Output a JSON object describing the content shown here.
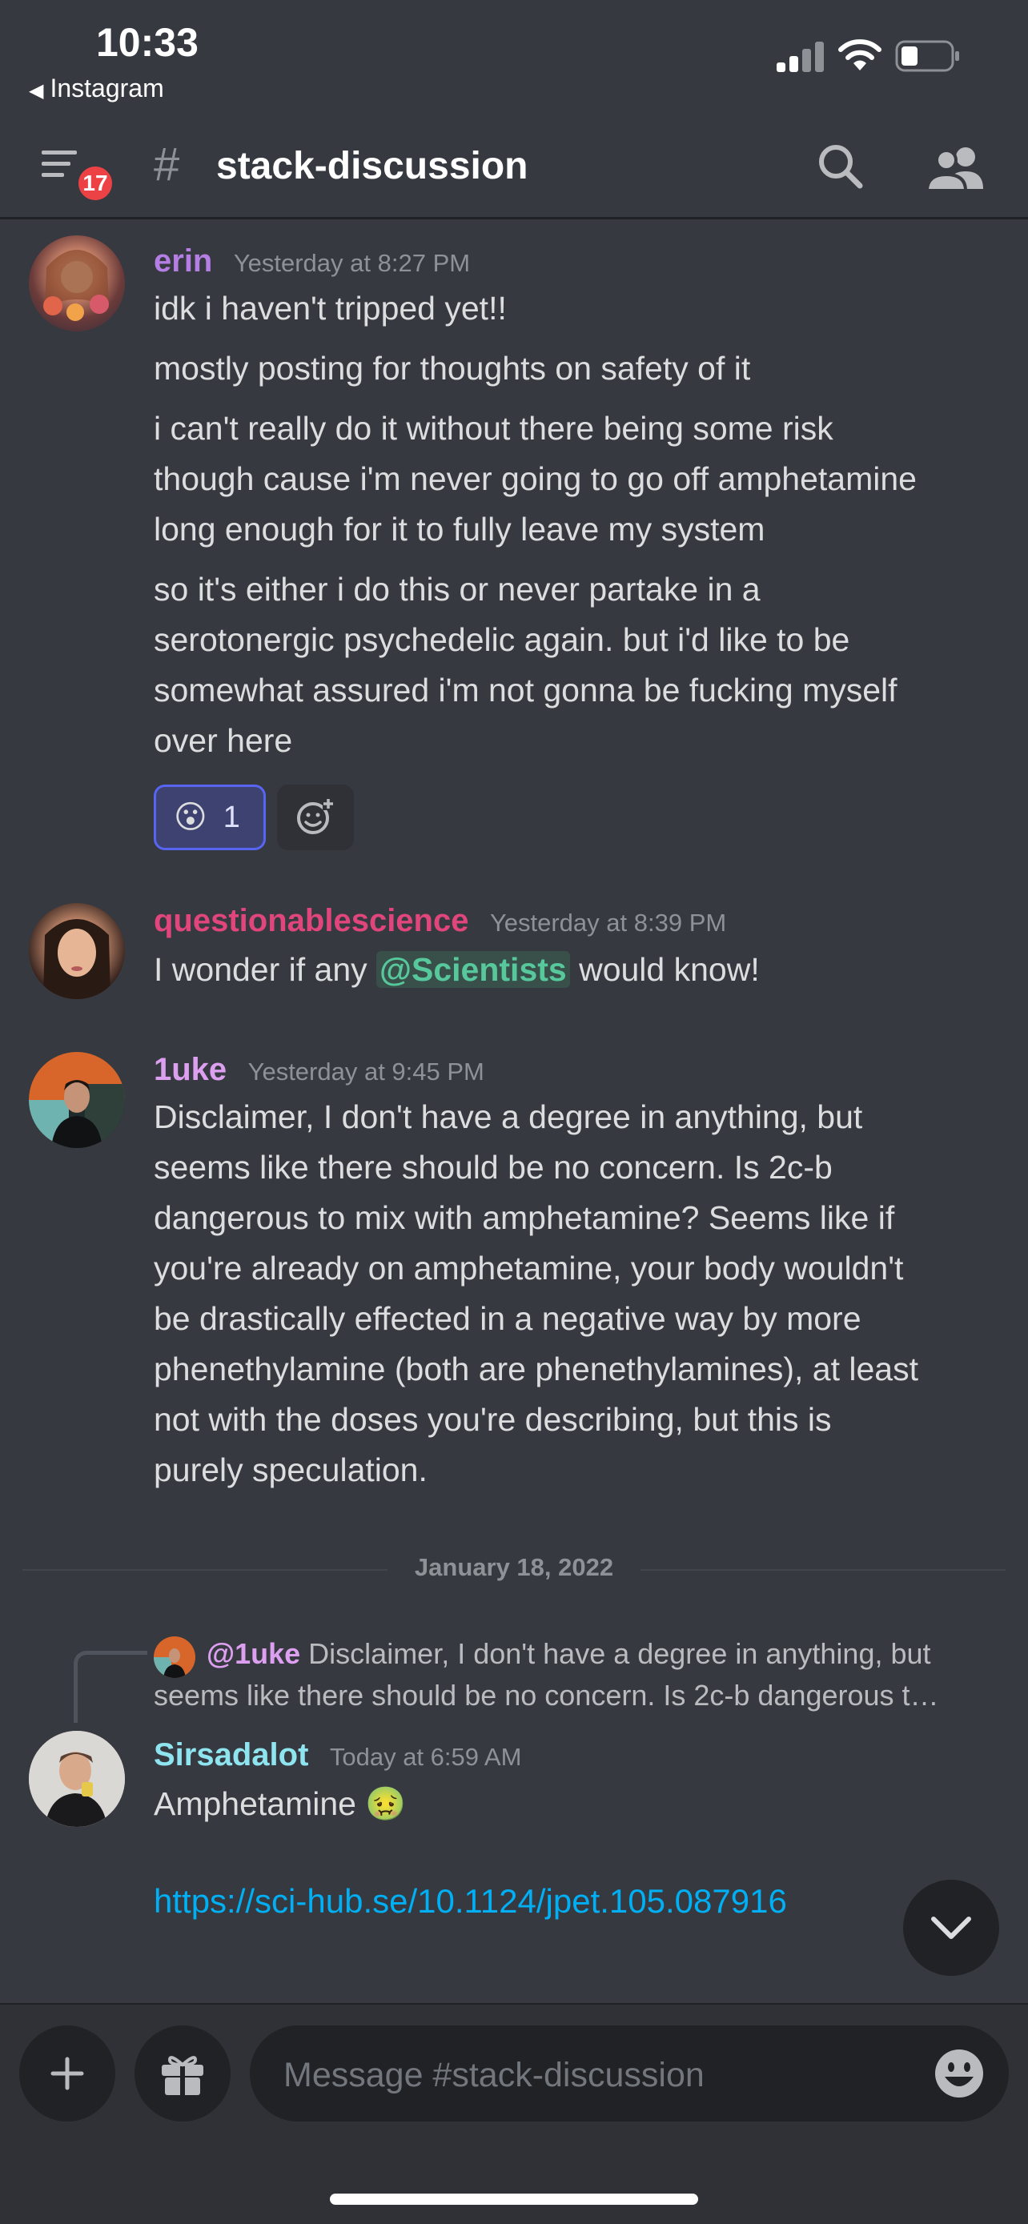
{
  "status_bar": {
    "time": "10:33",
    "back_app": "Instagram"
  },
  "header": {
    "unread_badge": "17",
    "hash": "#",
    "channel_name": "stack-discussion"
  },
  "messages": [
    {
      "author": "erin",
      "author_color": "#b47ee5",
      "timestamp": "Yesterday at 8:27 PM",
      "lines": [
        [
          "idk i haven't tripped yet!!"
        ],
        [
          "mostly posting for thoughts on safety of it"
        ],
        [
          "i can't really do it without there being some risk",
          "though cause i'm never going to go off amphetamine",
          "long enough for it to fully leave my system"
        ],
        [
          "so it's either i do this or never partake in a",
          "serotonergic psychedelic again. but i'd like to be",
          "somewhat assured i'm not gonna be fucking myself",
          "over here"
        ]
      ],
      "reaction": {
        "emoji": "😮",
        "count": "1"
      }
    },
    {
      "author": "questionablescience",
      "author_color": "#e0457b",
      "timestamp": "Yesterday at 8:39 PM",
      "text_before": "I wonder if any ",
      "mention": "@Scientists",
      "text_after": " would know!"
    },
    {
      "author": "1uke",
      "author_color": "#dda0f0",
      "timestamp": "Yesterday at 9:45 PM",
      "lines": [
        "Disclaimer, I don't have a degree in anything, but",
        "seems like there should be no concern. Is 2c-b",
        "dangerous to mix with amphetamine? Seems like if",
        "you're already on amphetamine, your body wouldn't",
        "be drastically effected in a negative way by more",
        "phenethylamine (both are phenethylamines), at least",
        "not with the doses you're describing, but this is",
        "purely speculation."
      ]
    },
    {
      "author": "Sirsadalot",
      "author_color": "#8ee4ef",
      "timestamp": "Today at 6:59 AM",
      "reply": {
        "author": "@1uke",
        "line1": " Disclaimer, I don't have a degree in anything, but",
        "line2": "seems like there should be no concern. Is 2c-b dangerous t…"
      },
      "text": "Amphetamine",
      "emoji": "🤢",
      "link": "https://sci-hub.se/10.1124/jpet.105.087916"
    }
  ],
  "date_divider": "January 18, 2022",
  "composer": {
    "placeholder": "Message #stack-discussion"
  },
  "colors": {
    "background": "#36393f",
    "composer_bg": "#2f3136",
    "accent": "#5865f2",
    "link": "#00aff4",
    "badge": "#ed4245"
  }
}
